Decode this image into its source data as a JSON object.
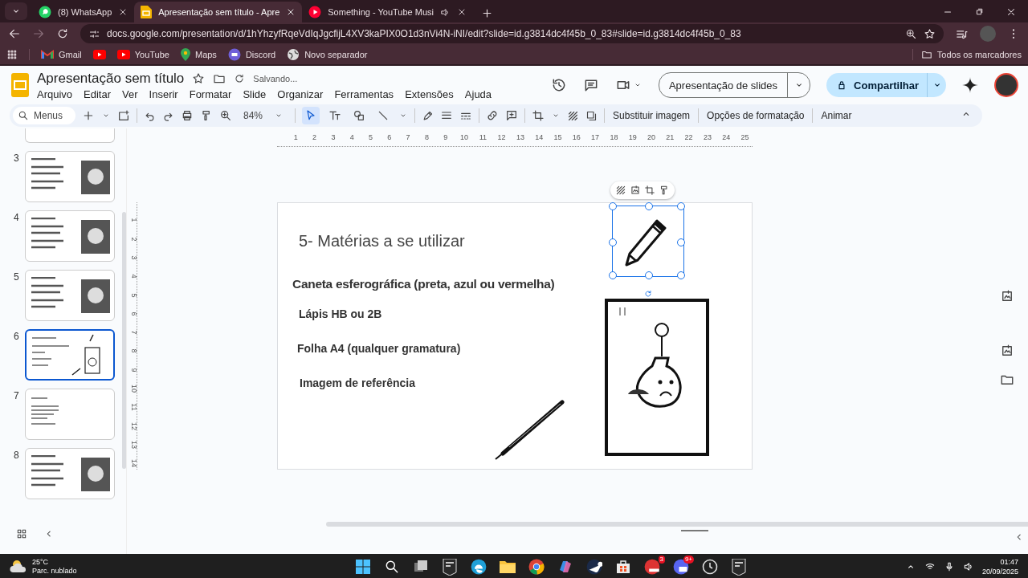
{
  "browser": {
    "tabs": [
      {
        "kind": "whatsapp",
        "title": "(8) WhatsApp",
        "selected": false,
        "audio": false
      },
      {
        "kind": "slides",
        "title": "Apresentação sem título - Apre",
        "selected": true,
        "audio": false
      },
      {
        "kind": "music",
        "title": "Something - YouTube Musi",
        "selected": false,
        "audio": true
      }
    ],
    "url": "docs.google.com/presentation/d/1hYhzyfRqeVdIqJgcfijL4XV3kaPIX0O1d3nVi4N-iNI/edit?slide=id.g3814dc4f45b_0_83#slide=id.g3814dc4f45b_0_83",
    "bookmarks": [
      {
        "kind": "gmail",
        "label": "Gmail"
      },
      {
        "kind": "youtube"
      },
      {
        "kind": "youtube",
        "label": "YouTube"
      },
      {
        "kind": "maps",
        "label": "Maps"
      },
      {
        "kind": "discord",
        "label": "Discord"
      },
      {
        "kind": "globe",
        "label": "Novo separador"
      }
    ],
    "all_bookmarks": "Todos os marcadores"
  },
  "doc": {
    "title": "Apresentação sem título",
    "save_status": "Salvando...",
    "menus": [
      "Arquivo",
      "Editar",
      "Ver",
      "Inserir",
      "Formatar",
      "Slide",
      "Organizar",
      "Ferramentas",
      "Extensões",
      "Ajuda"
    ],
    "slideshow_button": "Apresentação de slides",
    "share_button": "Compartilhar"
  },
  "toolbar": {
    "search": {
      "placeholder": "Menus"
    },
    "zoom": "84%",
    "tools": [
      {
        "kind": "select",
        "selected": true
      },
      {
        "kind": "textbox",
        "selected": false
      },
      {
        "kind": "shape",
        "selected": false
      },
      {
        "kind": "line",
        "selected": false
      }
    ],
    "actions": [
      "Substituir imagem",
      "Opções de formatação",
      "Animar"
    ]
  },
  "ruler": {
    "horizontal": [
      "1",
      "2",
      "3",
      "4",
      "5",
      "6",
      "7",
      "8",
      "9",
      "10",
      "11",
      "12",
      "13",
      "14",
      "15",
      "16",
      "17",
      "18",
      "19",
      "20",
      "21",
      "22",
      "23",
      "24",
      "25"
    ],
    "vertical": [
      "1",
      "2",
      "3",
      "4",
      "5",
      "6",
      "7",
      "8",
      "9",
      "10",
      "11",
      "12",
      "13",
      "14"
    ]
  },
  "filmstrip": [
    {
      "number": "3",
      "selected": false,
      "kind": "picture"
    },
    {
      "number": "4",
      "selected": false,
      "kind": "picture"
    },
    {
      "number": "5",
      "selected": false,
      "kind": "picture"
    },
    {
      "number": "6",
      "selected": true,
      "kind": "sketch"
    },
    {
      "number": "7",
      "selected": false,
      "kind": "text"
    },
    {
      "number": "8",
      "selected": false,
      "kind": "picture"
    }
  ],
  "slide": {
    "title": "5- Matérias a se utilizar",
    "heading": "Caneta esferográfica (preta, azul ou vermelha)",
    "items": [
      "Lápis HB ou 2B",
      "Folha A4 (qualquer gramatura)",
      "Imagem de referência"
    ],
    "pencil_selected": true
  },
  "taskbar": {
    "temperature": "25°C",
    "weather": "Parc. nublado",
    "time": "01:47",
    "date": "20/09/2025",
    "apps": [
      {
        "kind": "start"
      },
      {
        "kind": "search"
      },
      {
        "kind": "taskview"
      },
      {
        "kind": "epic"
      },
      {
        "kind": "edge"
      },
      {
        "kind": "files"
      },
      {
        "kind": "chrome"
      },
      {
        "kind": "copilot"
      },
      {
        "kind": "steam"
      },
      {
        "kind": "store"
      },
      {
        "kind": "game",
        "badge": "3"
      },
      {
        "kind": "discord",
        "badge": "9+"
      },
      {
        "kind": "clock"
      },
      {
        "kind": "epic"
      }
    ]
  }
}
